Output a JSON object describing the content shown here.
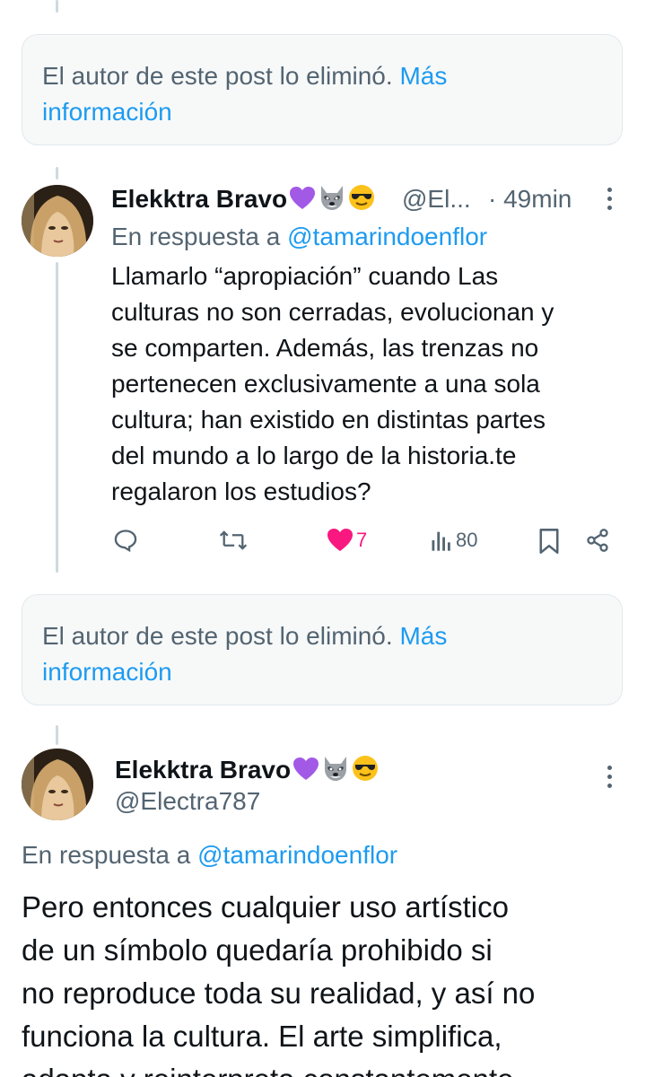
{
  "deleted_notice": {
    "text": "El autor de este post lo eliminó.",
    "link_line1": "Más",
    "link_line2": "información"
  },
  "tweet1": {
    "display_name": "Elekktra Bravo",
    "handle": "@El...",
    "time": "· 49min",
    "reply_prefix": "En respuesta a",
    "reply_handle": "@tamarindoenflor",
    "body_lines": [
      "Llamarlo “apropiación” cuando Las",
      "culturas no son cerradas, evolucionan y",
      "se comparten. Además, las trenzas no",
      "pertenecen exclusivamente a una sola",
      "cultura; han existido en distintas partes",
      "del mundo a lo largo de la historia.te",
      "regalaron los estudios?"
    ],
    "likes": "7",
    "views": "80",
    "colors": {
      "like": "#f91880",
      "accent": "#1d9bf0"
    }
  },
  "tweet2": {
    "display_name": "Elekktra Bravo",
    "handle": "@Electra787",
    "reply_prefix": "En respuesta a",
    "reply_handle": "@tamarindoenflor",
    "body_lines": [
      "Pero entonces cualquier uso artístico",
      "de un símbolo quedaría prohibido si",
      "no reproduce toda su realidad, y así no",
      "funciona la cultura. El arte simplifica,",
      "adapta y reinterpreta constantemente"
    ]
  },
  "icons": [
    "purple-heart-emoji",
    "raccoon-emoji",
    "sunglasses-emoji",
    "more-icon",
    "reply-icon",
    "retweet-icon",
    "like-icon",
    "views-icon",
    "bookmark-icon",
    "share-icon"
  ]
}
